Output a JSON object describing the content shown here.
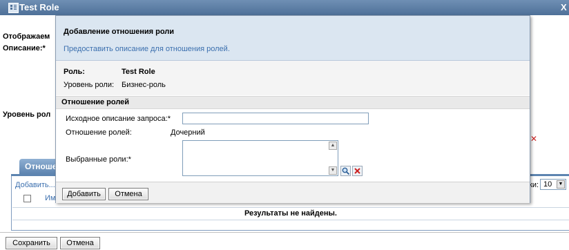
{
  "window": {
    "title": "Test Role",
    "close_glyph": "X"
  },
  "outer": {
    "display_name_label": "Отображаем",
    "description_label": "Описание:*",
    "role_level_label": "Уровень рол",
    "tab_label": "Отноше",
    "add_link": "Добавить...",
    "name_col": "Им",
    "rows_label": "ки:",
    "rows_value": "10",
    "no_results": "Результаты не найдены.",
    "save_button": "Сохранить",
    "cancel_button": "Отмена"
  },
  "modal": {
    "title": "Добавление отношения роли",
    "description": "Предоставить описание для отношения ролей.",
    "role_label": "Роль:",
    "role_value": "Test Role",
    "role_level_label": "Уровень роли:",
    "role_level_value": "Бизнес-роль",
    "section_title": "Отношение ролей",
    "request_desc_label": "Исходное описание запроса:*",
    "request_desc_value": "",
    "relationship_label": "Отношение ролей:",
    "relationship_value": "Дочерний",
    "selected_roles_label": "Выбранные роли:*",
    "add_button": "Добавить",
    "cancel_button": "Отмена"
  },
  "colors": {
    "title_bar": "#4e7098",
    "modal_header": "#dbe6f1",
    "link": "#3b6fae",
    "remove_icon": "#cc2222"
  },
  "icons": [
    "role-icon",
    "close-icon",
    "search-icon",
    "remove-icon",
    "scroll-up-icon",
    "scroll-down-icon",
    "dropdown-arrow-icon",
    "checkbox"
  ]
}
